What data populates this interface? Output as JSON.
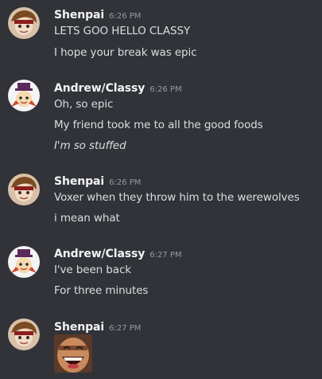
{
  "messages": [
    {
      "author": "Shenpai",
      "time": "6:26 PM",
      "avatar": "shenpai-avatar",
      "lines": [
        {
          "text": "LETS GOO HELLO CLASSY"
        },
        {
          "text": "I hope your break was epic"
        }
      ]
    },
    {
      "author": "Andrew/Classy",
      "time": "6:26 PM",
      "avatar": "andrew-avatar",
      "lines": [
        {
          "text": "Oh, so epic"
        },
        {
          "text": "My friend took me to all the good foods"
        },
        {
          "text": "I'm so stuffed",
          "italic": true
        }
      ]
    },
    {
      "author": "Shenpai",
      "time": "6:26 PM",
      "avatar": "shenpai-avatar",
      "lines": [
        {
          "text": "Voxer when they throw him to the werewolves"
        },
        {
          "text": "i mean what"
        }
      ]
    },
    {
      "author": "Andrew/Classy",
      "time": "6:27 PM",
      "avatar": "andrew-avatar",
      "lines": [
        {
          "text": "I've been back"
        },
        {
          "text": "For three minutes"
        }
      ]
    },
    {
      "author": "Shenpai",
      "time": "6:27 PM",
      "avatar": "shenpai-avatar",
      "attachment": "laughing-emoji-image"
    }
  ],
  "colors": {
    "background": "#313338",
    "author": "#f2f3f5",
    "timestamp": "#949ba4",
    "text": "#dbdee1"
  }
}
